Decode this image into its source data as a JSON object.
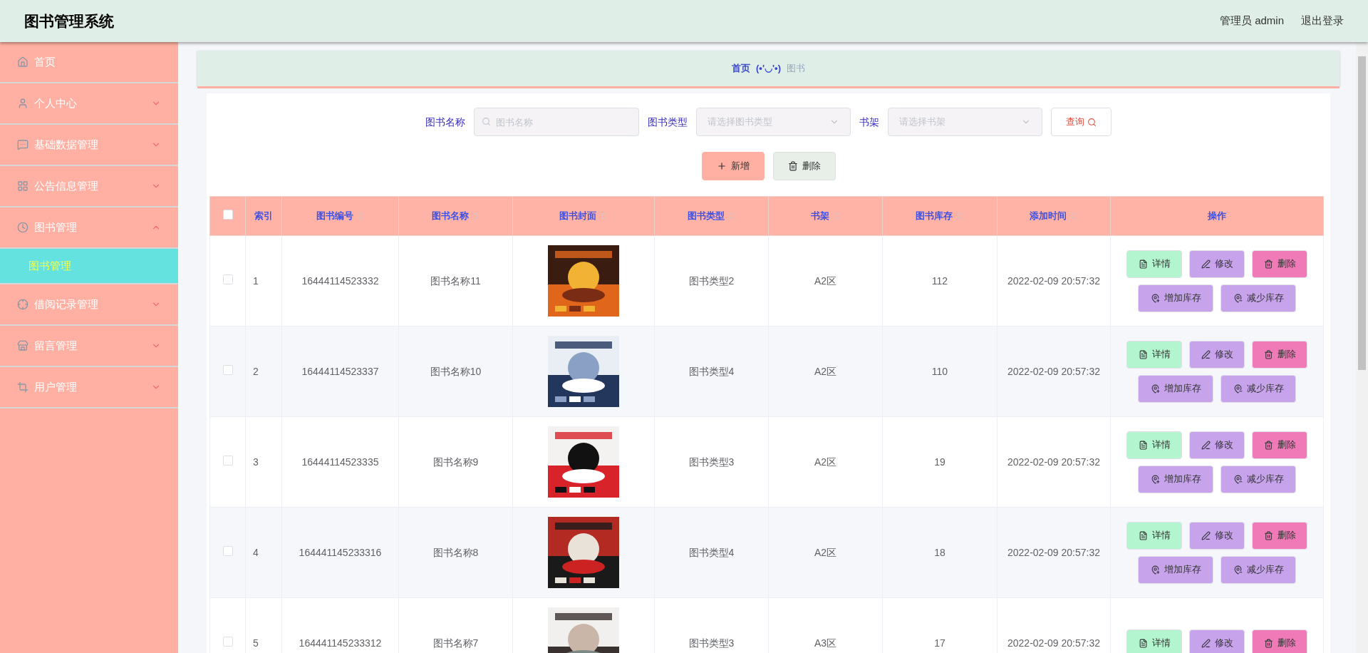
{
  "header": {
    "title": "图书管理系统",
    "user": "管理员 admin",
    "logout": "退出登录"
  },
  "sidebar": {
    "items": [
      {
        "label": "首页"
      },
      {
        "label": "个人中心",
        "expanded": false
      },
      {
        "label": "基础数据管理",
        "expanded": false
      },
      {
        "label": "公告信息管理",
        "expanded": false
      },
      {
        "label": "图书管理",
        "expanded": true,
        "children": [
          {
            "label": "图书管理",
            "selected": true
          }
        ]
      },
      {
        "label": "借阅记录管理",
        "expanded": false
      },
      {
        "label": "留言管理",
        "expanded": false
      },
      {
        "label": "用户管理",
        "expanded": false
      }
    ]
  },
  "breadcrumb": {
    "home": "首页",
    "separator": "(•'◡'•)",
    "current": "图书"
  },
  "search": {
    "fields": [
      {
        "kind": "input",
        "label": "图书名称",
        "placeholder": "图书名称"
      },
      {
        "kind": "select",
        "label": "图书类型",
        "placeholder": "请选择图书类型"
      },
      {
        "kind": "select",
        "label": "书架",
        "placeholder": "请选择书架"
      }
    ],
    "button": "查询"
  },
  "toolbar": [
    {
      "kind": "add",
      "label": "新增"
    },
    {
      "kind": "delete",
      "label": "删除"
    }
  ],
  "table": {
    "select_all_checked": false,
    "columns": [
      {
        "label": "索引",
        "sortable": false
      },
      {
        "label": "图书编号",
        "sortable": true
      },
      {
        "label": "图书名称",
        "sortable": true
      },
      {
        "label": "图书封面",
        "sortable": true
      },
      {
        "label": "图书类型",
        "sortable": true
      },
      {
        "label": "书架",
        "sortable": true
      },
      {
        "label": "图书库存",
        "sortable": true
      },
      {
        "label": "添加时间",
        "sortable": true
      },
      {
        "label": "操作",
        "sortable": false
      }
    ],
    "rows": [
      {
        "checked": false,
        "index": "1",
        "code": "16444114523332",
        "name": "图书名称11",
        "type": "图书类型2",
        "shelf": "A2区",
        "stock": "112",
        "time": "2022-02-09 20:57:32",
        "actions": [
          {
            "kind": "detail",
            "label": "详情"
          },
          {
            "kind": "edit",
            "label": "修改"
          },
          {
            "kind": "delete",
            "label": "删除"
          },
          {
            "kind": "add",
            "label": "增加库存"
          },
          {
            "kind": "reduce",
            "label": "减少库存"
          }
        ]
      },
      {
        "checked": false,
        "index": "2",
        "code": "16444114523337",
        "name": "图书名称10",
        "type": "图书类型4",
        "shelf": "A2区",
        "stock": "110",
        "time": "2022-02-09 20:57:32",
        "actions": [
          {
            "kind": "detail",
            "label": "详情"
          },
          {
            "kind": "edit",
            "label": "修改"
          },
          {
            "kind": "delete",
            "label": "删除"
          },
          {
            "kind": "add",
            "label": "增加库存"
          },
          {
            "kind": "reduce",
            "label": "减少库存"
          }
        ]
      },
      {
        "checked": false,
        "index": "3",
        "code": "16444114523335",
        "name": "图书名称9",
        "type": "图书类型3",
        "shelf": "A2区",
        "stock": "19",
        "time": "2022-02-09 20:57:32",
        "actions": [
          {
            "kind": "detail",
            "label": "详情"
          },
          {
            "kind": "edit",
            "label": "修改"
          },
          {
            "kind": "delete",
            "label": "删除"
          },
          {
            "kind": "add",
            "label": "增加库存"
          },
          {
            "kind": "reduce",
            "label": "减少库存"
          }
        ]
      },
      {
        "checked": false,
        "index": "4",
        "code": "164441145233316",
        "name": "图书名称8",
        "type": "图书类型4",
        "shelf": "A2区",
        "stock": "18",
        "time": "2022-02-09 20:57:32",
        "actions": [
          {
            "kind": "detail",
            "label": "详情"
          },
          {
            "kind": "edit",
            "label": "修改"
          },
          {
            "kind": "delete",
            "label": "删除"
          },
          {
            "kind": "add",
            "label": "增加库存"
          },
          {
            "kind": "reduce",
            "label": "减少库存"
          }
        ]
      },
      {
        "checked": false,
        "index": "5",
        "code": "164441145233312",
        "name": "图书名称7",
        "type": "图书类型3",
        "shelf": "A3区",
        "stock": "17",
        "time": "2022-02-09 20:57:32",
        "actions": [
          {
            "kind": "detail",
            "label": "详情"
          },
          {
            "kind": "edit",
            "label": "修改"
          },
          {
            "kind": "delete",
            "label": "删除"
          }
        ]
      }
    ]
  }
}
